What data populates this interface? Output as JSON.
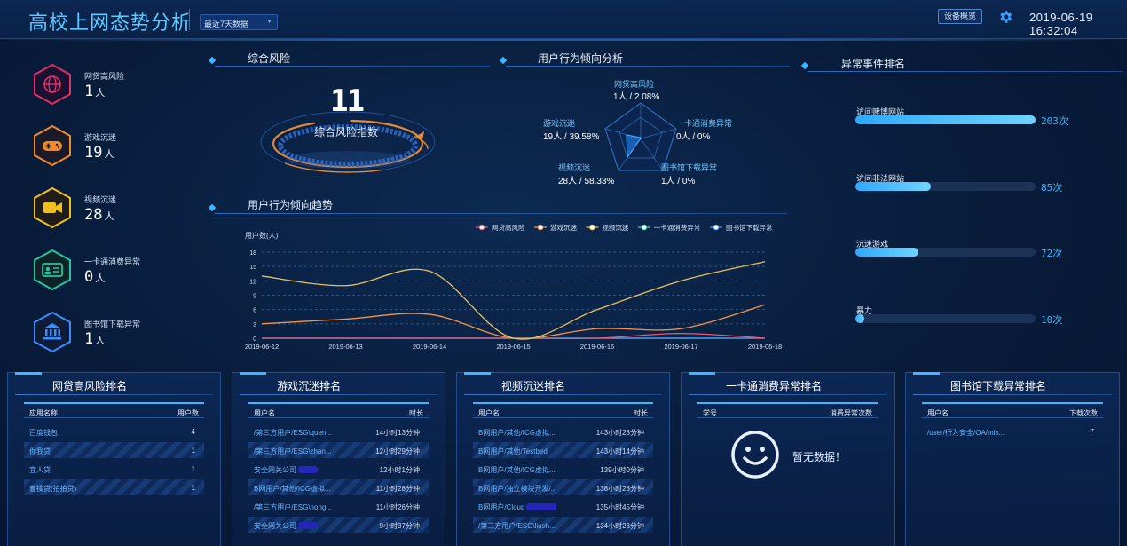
{
  "header": {
    "title": "高校上网态势分析",
    "range_select": "最近7天数据",
    "overview_button": "设备概览",
    "datetime": "2019-06-19 16:32:04"
  },
  "kpis": [
    {
      "label": "网贷高风险",
      "value": "1",
      "unit": "人",
      "icon": "globe-icon",
      "color": "#e0306a"
    },
    {
      "label": "游戏沉迷",
      "value": "19",
      "unit": "人",
      "icon": "gamepad-icon",
      "color": "#f08a2a"
    },
    {
      "label": "视频沉迷",
      "value": "28",
      "unit": "人",
      "icon": "video-camera-icon",
      "color": "#f0c020"
    },
    {
      "label": "一卡通消费异常",
      "value": "0",
      "unit": "人",
      "icon": "id-card-icon",
      "color": "#20c8a0"
    },
    {
      "label": "图书馆下载异常",
      "value": "1",
      "unit": "人",
      "icon": "library-icon",
      "color": "#3a8cff"
    }
  ],
  "risk": {
    "title": "综合风险",
    "value": "11",
    "label": "综合风险指数"
  },
  "radar": {
    "title": "用户行为倾向分析",
    "axes": [
      {
        "name": "网贷高风险",
        "value": "1人 / 2.08%"
      },
      {
        "name": "一卡通消费异常",
        "value": "0人 / 0%"
      },
      {
        "name": "图书馆下载异常",
        "value": "1人 / 0%"
      },
      {
        "name": "视频沉迷",
        "value": "28人 / 58.33%"
      },
      {
        "name": "游戏沉迷",
        "value": "19人 / 39.58%"
      }
    ]
  },
  "trend": {
    "title": "用户行为倾向趋势"
  },
  "chart_data": {
    "type": "line",
    "title": "",
    "xlabel": "",
    "ylabel": "用户数(人)",
    "ylim": [
      0,
      18
    ],
    "yticks": [
      0,
      3,
      6,
      9,
      12,
      15,
      18
    ],
    "x": [
      "2019-06-12",
      "2019-06-13",
      "2019-06-14",
      "2019-06-15",
      "2019-06-16",
      "2019-06-17",
      "2019-06-18"
    ],
    "series": [
      {
        "name": "网贷高风险",
        "color": "#e05a7a",
        "values": [
          0,
          0,
          0,
          0,
          0,
          1,
          0
        ]
      },
      {
        "name": "游戏沉迷",
        "color": "#f2944a",
        "values": [
          3,
          4,
          5,
          0,
          2,
          2,
          7
        ]
      },
      {
        "name": "视频沉迷",
        "color": "#e8c060",
        "values": [
          13,
          11,
          14,
          0,
          6,
          12,
          16
        ]
      },
      {
        "name": "一卡通消费异常",
        "color": "#40d8c8",
        "values": [
          0,
          0,
          0,
          0,
          0,
          0,
          0
        ]
      },
      {
        "name": "图书馆下载异常",
        "color": "#5a9cff",
        "values": [
          0,
          0,
          0,
          0,
          0,
          0,
          0
        ]
      }
    ],
    "legend": "top-right",
    "grid": true
  },
  "anomaly": {
    "title": "异常事件排名",
    "items": [
      {
        "label": "访问赌博网站",
        "count": "203次",
        "ratio": 1.0
      },
      {
        "label": "访问非法网站",
        "count": "85次",
        "ratio": 0.42
      },
      {
        "label": "沉迷游戏",
        "count": "72次",
        "ratio": 0.35
      },
      {
        "label": "暴力",
        "count": "10次",
        "ratio": 0.05
      }
    ]
  },
  "panels": {
    "loan": {
      "title": "网贷高风险排名",
      "headers": [
        "应用名称",
        "用户数"
      ],
      "rows": [
        {
          "name": "百度钱包",
          "value": "4"
        },
        {
          "name": "你我贷",
          "value": "1"
        },
        {
          "name": "宜人贷",
          "value": "1"
        },
        {
          "name": "曹操贷(拍拍贷)",
          "value": "1"
        }
      ]
    },
    "game": {
      "title": "游戏沉迷排名",
      "headers": [
        "用户名",
        "时长"
      ],
      "rows": [
        {
          "name": "/第三方用户/ESG\\quen...",
          "value": "14小时13分钟"
        },
        {
          "name": "/第三方用户/ESG\\zhan...",
          "value": "12小时29分钟"
        },
        {
          "name": "安全网关公司",
          "value": "12小时1分钟",
          "redacted": true
        },
        {
          "name": "B网用户/其他/ICG虚拟...",
          "value": "11小时28分钟"
        },
        {
          "name": "/第三方用户/ESG\\hong...",
          "value": "11小时26分钟"
        },
        {
          "name": "安全网关公司",
          "value": "9小时37分钟",
          "redacted": true
        }
      ]
    },
    "video": {
      "title": "视频沉迷排名",
      "headers": [
        "用户名",
        "时长"
      ],
      "rows": [
        {
          "name": "B网用户/其他/ICG虚拟...",
          "value": "143小时23分钟"
        },
        {
          "name": "B网用户/其他/Testbed",
          "value": "143小时14分钟"
        },
        {
          "name": "B网用户/其他/ICG虚拟...",
          "value": "139小时0分钟"
        },
        {
          "name": "B网用户/独立模块开发/...",
          "value": "138小时23分钟"
        },
        {
          "name": "B网用户/Cloud",
          "value": "135小时45分钟",
          "redacted": true
        },
        {
          "name": "/第三方用户/ESG\\liush...",
          "value": "134小时23分钟"
        }
      ]
    },
    "card": {
      "title": "一卡通消费异常排名",
      "headers": [
        "学号",
        "消费异常次数"
      ],
      "nodata": "暂无数据！"
    },
    "library": {
      "title": "图书馆下载异常排名",
      "headers": [
        "用户名",
        "下载次数"
      ],
      "rows": [
        {
          "name": "/user/行为安全/OA/mis...",
          "value": "7"
        }
      ]
    }
  }
}
